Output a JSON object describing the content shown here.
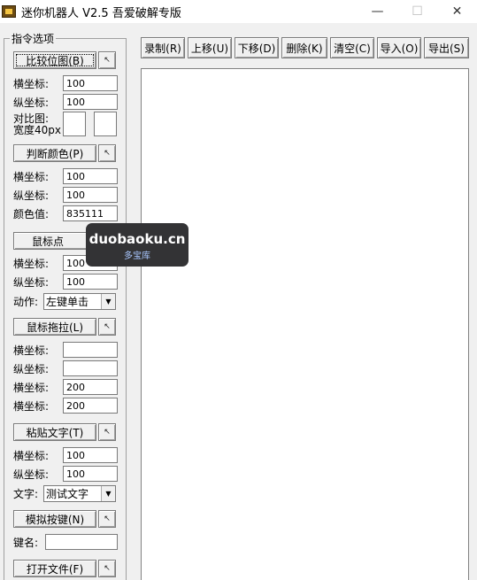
{
  "window": {
    "title": "迷你机器人 V2.5 吾爱破解专版",
    "minimize": "—",
    "maximize": "☐",
    "close": "✕"
  },
  "panel": {
    "legend": "指令选项",
    "compare_image": {
      "button": "比较位图(B)",
      "x_label": "横坐标:",
      "x_value": "100",
      "y_label": "纵坐标:",
      "y_value": "100",
      "image_label_1": "对比图:",
      "image_label_2": "宽度40px"
    },
    "check_color": {
      "button": "判断颜色(P)",
      "x_label": "横坐标:",
      "x_value": "100",
      "y_label": "纵坐标:",
      "y_value": "100",
      "color_label": "颜色值:",
      "color_value": "835111"
    },
    "mouse_click": {
      "button": "鼠标点",
      "x_label": "横坐标:",
      "x_value": "100",
      "y_label": "纵坐标:",
      "y_value": "100",
      "action_label": "动作:",
      "action_value": "左键单击"
    },
    "mouse_drag": {
      "button": "鼠标拖拉(L)",
      "x1_label": "横坐标:",
      "x1_value": "",
      "y1_label": "纵坐标:",
      "y1_value": "",
      "x2_label": "横坐标:",
      "x2_value": "200",
      "y2_label": "横坐标:",
      "y2_value": "200"
    },
    "paste_text": {
      "button": "粘贴文字(T)",
      "x_label": "横坐标:",
      "x_value": "100",
      "y_label": "纵坐标:",
      "y_value": "100",
      "text_label": "文字:",
      "text_value": "测试文字"
    },
    "simulate_key": {
      "button": "模拟按键(N)",
      "key_label": "键名:",
      "key_value": ""
    },
    "open_file": {
      "button": "打开文件(F)"
    },
    "arrow": "↖"
  },
  "toolbar": {
    "record": "录制(R)",
    "move_up": "上移(U)",
    "move_down": "下移(D)",
    "delete": "删除(K)",
    "clear": "清空(C)",
    "import": "导入(O)",
    "export": "导出(S)"
  },
  "watermark": {
    "main": "duobaoku.cn",
    "sub": "多宝库"
  }
}
